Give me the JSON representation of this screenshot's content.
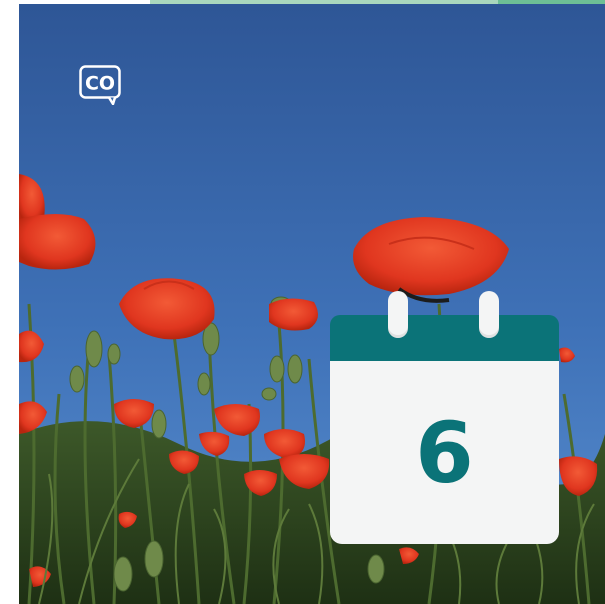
{
  "logo": {
    "text": "CO"
  },
  "calendar": {
    "day": "6"
  },
  "colors": {
    "sky_top": "#2f5a9a",
    "sky_bottom": "#4a7fc6",
    "calendar_header": "#0b7378",
    "calendar_body": "#f4f5f5",
    "poppy_red": "#e0361f"
  },
  "icons": [
    "co-logo-icon",
    "calendar-icon"
  ]
}
